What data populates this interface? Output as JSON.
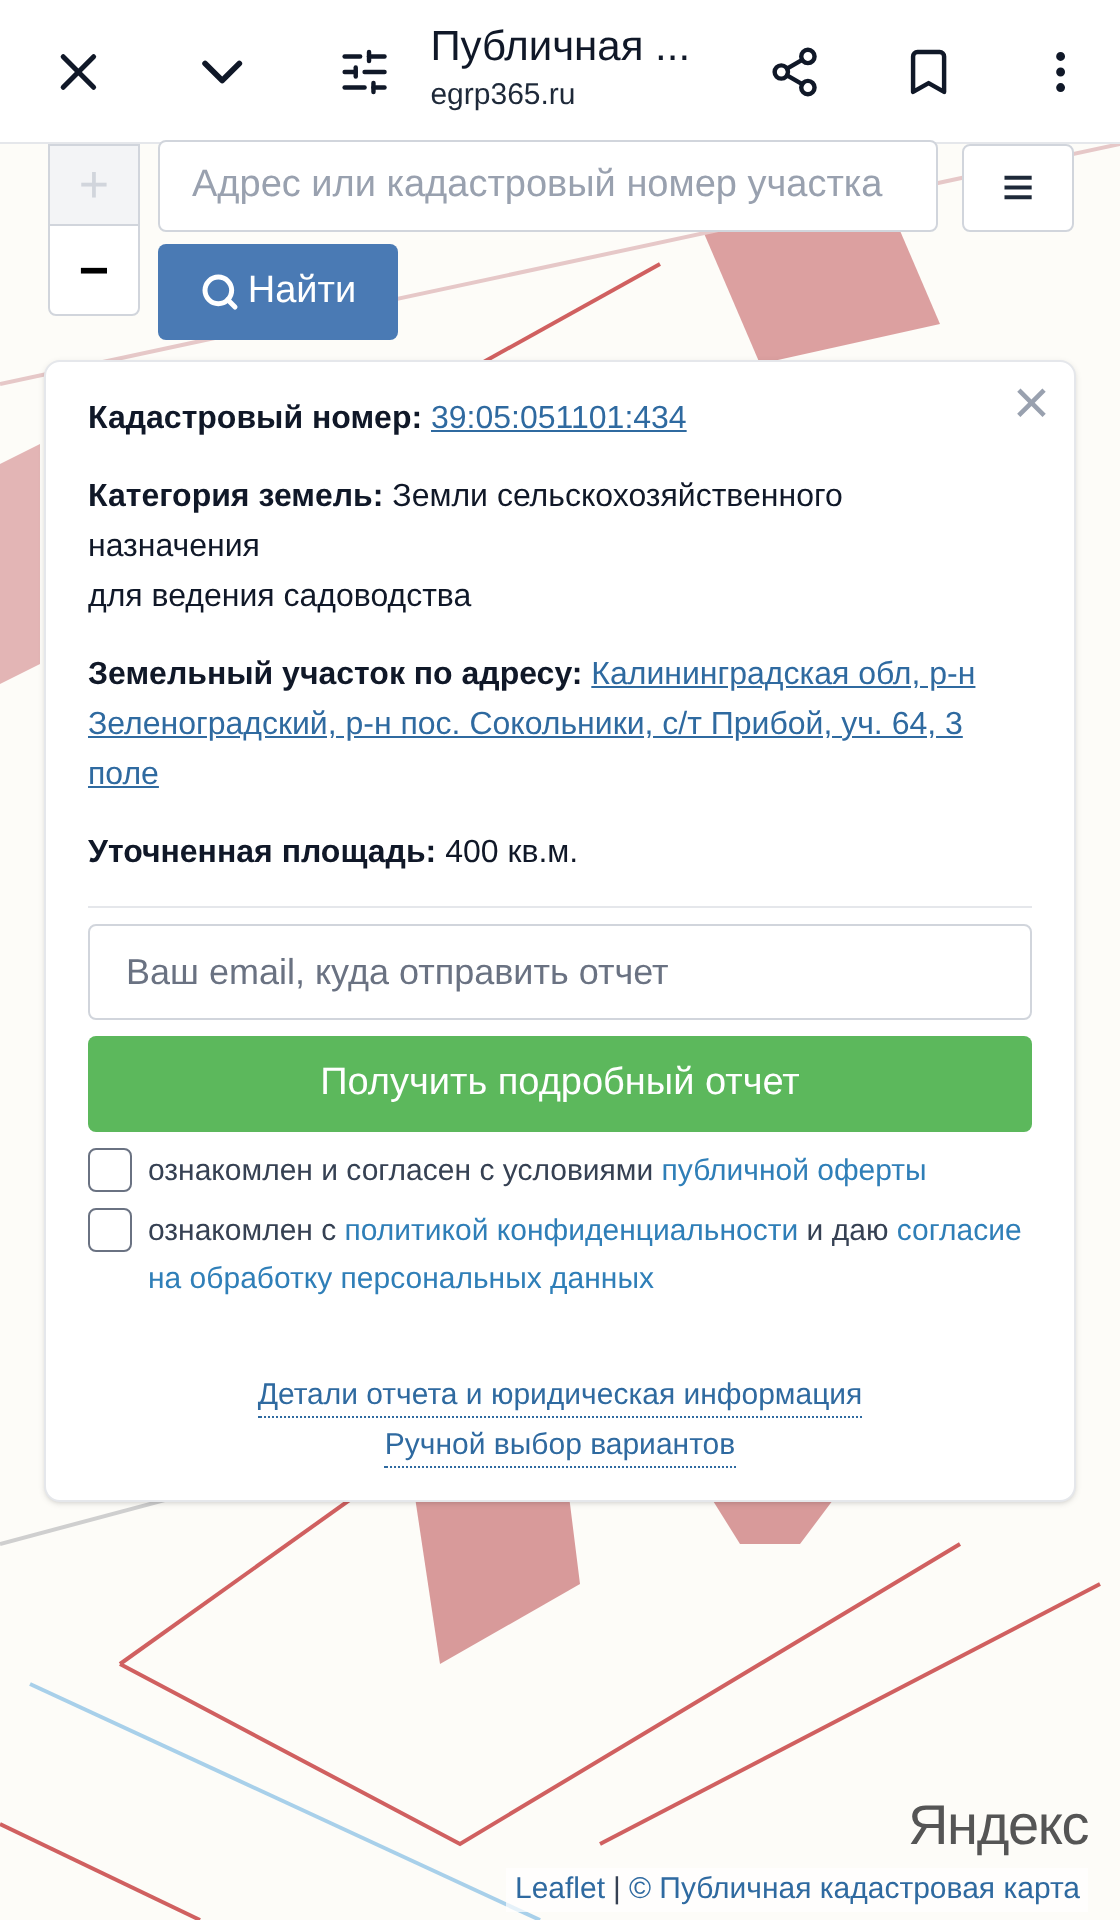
{
  "browser_bar": {
    "title": "Публичная ...",
    "url": "egrp365.ru"
  },
  "map": {
    "kind": "picture",
    "zoom_in": "+",
    "zoom_out": "−",
    "search": {
      "placeholder": "Адрес или кадастровый номер участка"
    },
    "find_button": "Найти",
    "menu": "≡"
  },
  "popup": {
    "close": "×",
    "fields": [
      {
        "kind": "link",
        "label": "Кадастровый номер:",
        "value": "39:05:051101:434"
      },
      {
        "kind": "text",
        "label": "Категория земель:",
        "value": "Земли сельскохозяйственного назначения",
        "extra": "для ведения садоводства"
      },
      {
        "kind": "link",
        "label": "Земельный участок по адресу:",
        "value": "Калининградская обл, р-н Зеленоградский, р-н пос. Сокольники, с/т Прибой, уч. 64, 3 поле"
      },
      {
        "kind": "text",
        "label": "Уточненная площадь:",
        "value": "400 кв.м."
      }
    ],
    "email": {
      "placeholder": "Ваш email, куда отправить отчет"
    },
    "submit": "Получить подробный отчет",
    "agreements": [
      {
        "checked": false,
        "parts": [
          {
            "text": "ознакомлен и согласен с условиями ",
            "link": false
          },
          {
            "text": "публичной оферты",
            "link": true
          }
        ]
      },
      {
        "checked": false,
        "parts": [
          {
            "text": "ознакомлен с ",
            "link": false
          },
          {
            "text": "политикой конфиденциальности",
            "link": true
          },
          {
            "text": " и даю ",
            "link": false
          },
          {
            "text": "согласие на обработку персональных данных",
            "link": true
          }
        ]
      }
    ],
    "footer_links": [
      "Детали отчета и юридическая информация",
      "Ручной выбор вариантов"
    ]
  },
  "logo": "Яндекс",
  "attribution": {
    "leaflet": "Leaflet",
    "separator": "|",
    "source": "© Публичная кадастровая карта"
  }
}
